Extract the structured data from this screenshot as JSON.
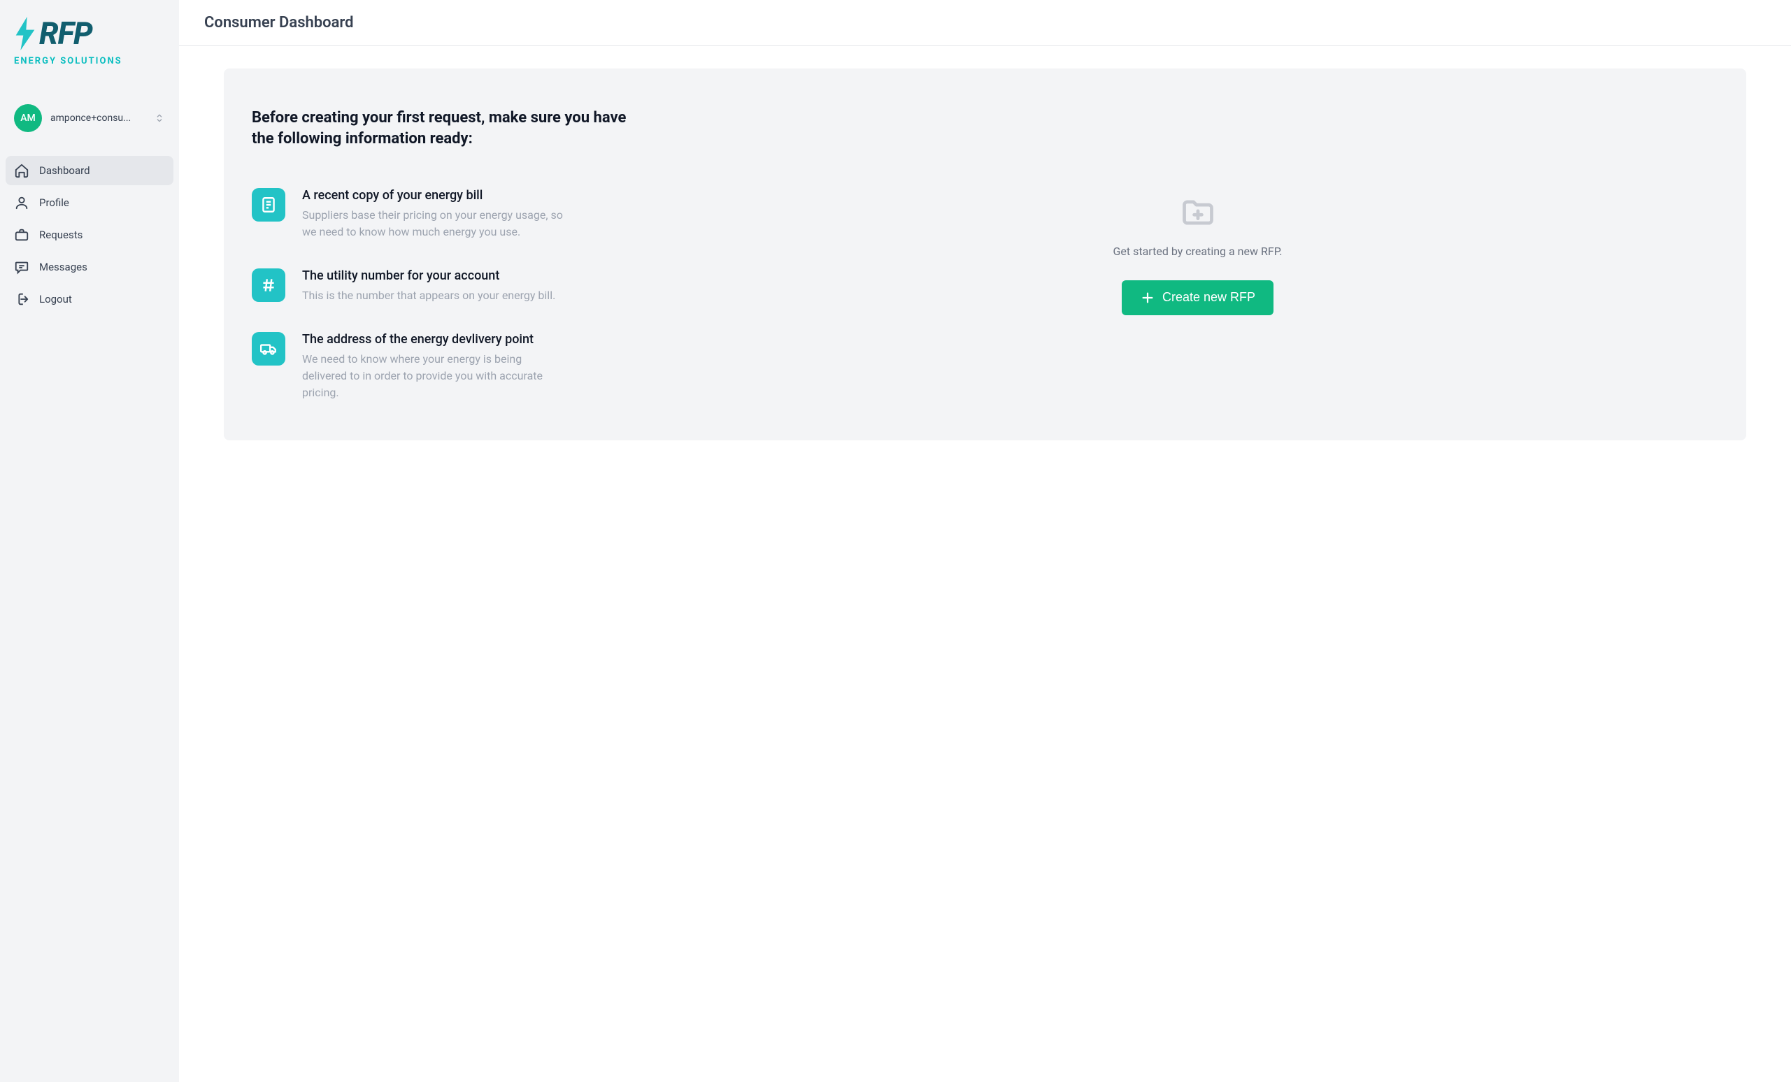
{
  "brand": {
    "name": "RFP",
    "tagline": "ENERGY SOLUTIONS",
    "colors": {
      "primary": "#115e6e",
      "accent": "#0bbec0",
      "success": "#10b981"
    }
  },
  "user": {
    "initials": "AM",
    "display": "amponce+consu..."
  },
  "sidebar": {
    "items": [
      {
        "key": "dashboard",
        "label": "Dashboard",
        "active": true,
        "icon": "home"
      },
      {
        "key": "profile",
        "label": "Profile",
        "active": false,
        "icon": "user"
      },
      {
        "key": "requests",
        "label": "Requests",
        "active": false,
        "icon": "briefcase"
      },
      {
        "key": "messages",
        "label": "Messages",
        "active": false,
        "icon": "message"
      },
      {
        "key": "logout",
        "label": "Logout",
        "active": false,
        "icon": "logout"
      }
    ]
  },
  "page": {
    "title": "Consumer Dashboard"
  },
  "onboarding": {
    "heading": "Before creating your first request, make sure you have the following information ready:",
    "items": [
      {
        "icon": "receipt",
        "title": "A recent copy of your energy bill",
        "description": "Suppliers base their pricing on your energy usage, so we need to know how much energy you use."
      },
      {
        "icon": "hash",
        "title": "The utility number for your account",
        "description": "This is the number that appears on your energy bill."
      },
      {
        "icon": "truck",
        "title": "The address of the energy devlivery point",
        "description": "We need to know where your energy is being delivered to in order to provide you with accurate pricing."
      }
    ],
    "cta": {
      "prompt": "Get started by creating a new RFP.",
      "button_label": "Create new RFP"
    }
  }
}
